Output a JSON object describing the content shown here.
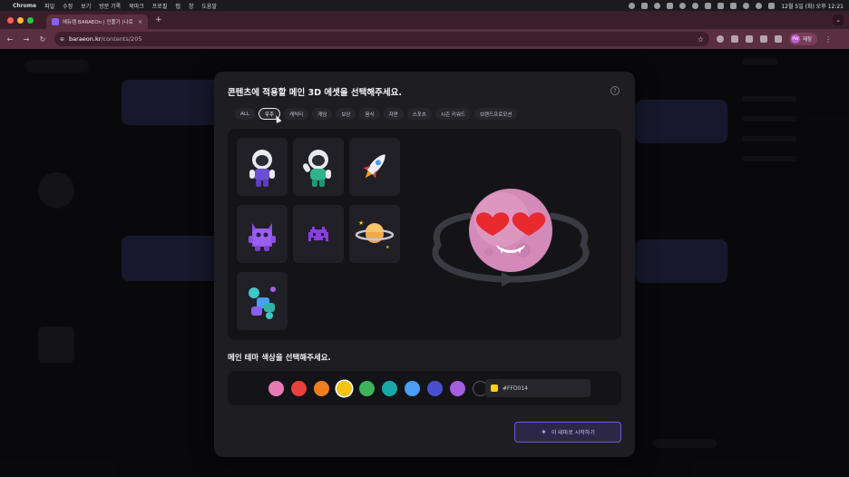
{
  "menubar": {
    "app": "Chrome",
    "items": [
      "파일",
      "수정",
      "보기",
      "방문 기록",
      "북마크",
      "프로필",
      "탭",
      "창",
      "도움말"
    ],
    "clock": "12월 5일 (화) 오후 12:21"
  },
  "browser": {
    "tab_title": "에듀캠 BARAEOn | 인플기 (나로 콘...",
    "tab_close": "×",
    "new_tab": "+",
    "tab_menu": "⌄",
    "back": "←",
    "forward": "→",
    "reload": "↻",
    "site_icon": "⊕",
    "url_host": "baraeon.kr",
    "url_path": "/contents/205",
    "bookmark_star": "☆",
    "profile_initials": "PW",
    "profile_label": "재창",
    "menu": "⋮"
  },
  "modal": {
    "title": "콘텐츠에 적용할 메인 3D 에셋을 선택해주세요.",
    "help": "?",
    "categories": [
      "ALL",
      "우주",
      "캐릭터",
      "게임",
      "보상",
      "음식",
      "자연",
      "스포츠",
      "시즌 키워드",
      "브랜드프로모션"
    ],
    "active_category_index": 1,
    "assets": [
      "astronaut-purple",
      "astronaut-green",
      "rocket",
      "purple-monster",
      "pixel-invader",
      "planet-saturn",
      "blocks-cluster"
    ],
    "preview": "heart-eyes-planet",
    "theme_title": "메인 테마 색상을 선택해주세요.",
    "theme_colors": [
      "#e87ab8",
      "#e8403c",
      "#f07d1e",
      "#f4c316",
      "#3fb55a",
      "#17a8a8",
      "#4a9ef5",
      "#4a4fd2",
      "#a45ee0",
      "#141418"
    ],
    "selected_color_index": 3,
    "hex_value": "#FFD014",
    "hex_color": "#FFD014",
    "start_button": "이 테마로 시작하기",
    "start_icon": "✦"
  }
}
